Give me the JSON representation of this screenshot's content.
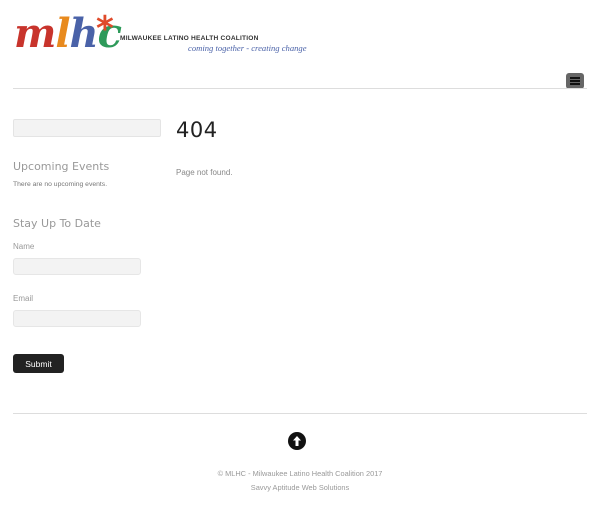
{
  "header": {
    "logo_text": "mlhc*",
    "org_name": "MILWAUKEE LATINO HEALTH COALITION",
    "tagline": "coming together - creating change",
    "menu_icon": "hamburger-menu-icon"
  },
  "sidebar": {
    "search": {
      "value": "",
      "placeholder": ""
    },
    "events": {
      "heading": "Upcoming Events",
      "empty_text": "There are no upcoming events."
    },
    "newsletter": {
      "heading": "Stay Up To Date",
      "name_label": "Name",
      "name_value": "",
      "email_label": "Email",
      "email_value": "",
      "submit_label": "Submit"
    }
  },
  "main": {
    "heading": "404",
    "message": "Page not found."
  },
  "footer": {
    "back_to_top_icon": "arrow-up-circle-icon",
    "copyright": "© MLHC - Milwaukee Latino Health Coalition 2017",
    "credit": "Savvy Aptitude Web Solutions"
  },
  "colors": {
    "logo_red": "#c8342c",
    "logo_orange": "#e88a1e",
    "logo_blue": "#4a62a8",
    "logo_green": "#2e9a5a",
    "button_dark": "#222222"
  }
}
